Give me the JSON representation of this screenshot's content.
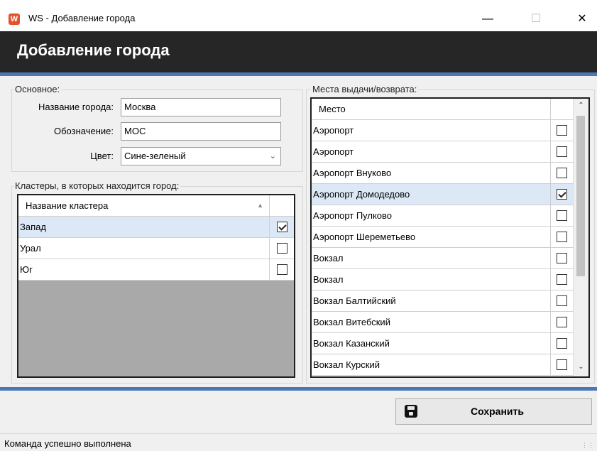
{
  "window": {
    "icon": "W",
    "title": "WS - Добавление города",
    "minimize": "—",
    "maximize": "☐",
    "close": "✕"
  },
  "header": {
    "title": "Добавление города"
  },
  "basic": {
    "caption": "Основное:",
    "city_name_label": "Название города:",
    "city_name_value": "Москва",
    "code_label": "Обозначение:",
    "code_value": "MOC",
    "color_label": "Цвет:",
    "color_value": "Сине-зеленый"
  },
  "clusters": {
    "caption": "Кластеры, в которых находится город:",
    "header": "Название кластера",
    "sort_icon": "▲",
    "rows": [
      {
        "name": "Запад",
        "checked": true,
        "selected": true
      },
      {
        "name": "Урал",
        "checked": false,
        "selected": false
      },
      {
        "name": "Юг",
        "checked": false,
        "selected": false
      }
    ]
  },
  "places": {
    "caption": "Места выдачи/возврата:",
    "header": "Место",
    "rows": [
      {
        "name": "Аэропорт",
        "checked": false,
        "selected": false
      },
      {
        "name": "Аэропорт",
        "checked": false,
        "selected": false
      },
      {
        "name": "Аэропорт Внуково",
        "checked": false,
        "selected": false
      },
      {
        "name": "Аэропорт Домодедово",
        "checked": true,
        "selected": true
      },
      {
        "name": "Аэропорт Пулково",
        "checked": false,
        "selected": false
      },
      {
        "name": "Аэропорт Шереметьево",
        "checked": false,
        "selected": false
      },
      {
        "name": "Вокзал",
        "checked": false,
        "selected": false
      },
      {
        "name": "Вокзал",
        "checked": false,
        "selected": false
      },
      {
        "name": "Вокзал Балтийский",
        "checked": false,
        "selected": false
      },
      {
        "name": "Вокзал Витебский",
        "checked": false,
        "selected": false
      },
      {
        "name": "Вокзал Казанский",
        "checked": false,
        "selected": false
      },
      {
        "name": "Вокзал Курский",
        "checked": false,
        "selected": false
      }
    ]
  },
  "save_button": {
    "label": "Сохранить"
  },
  "status": {
    "text": "Команда успешно выполнена"
  },
  "colors": {
    "header_bg": "#262626",
    "accent_blue": "#4a78b4",
    "selected_row": "#dce8f5",
    "grid_empty": "#a9a9a9"
  },
  "icons": {
    "app": "app-logo-icon",
    "save": "floppy-disk-icon",
    "scroll_up": "scroll-up-arrow-icon",
    "scroll_down": "scroll-down-arrow-icon"
  }
}
